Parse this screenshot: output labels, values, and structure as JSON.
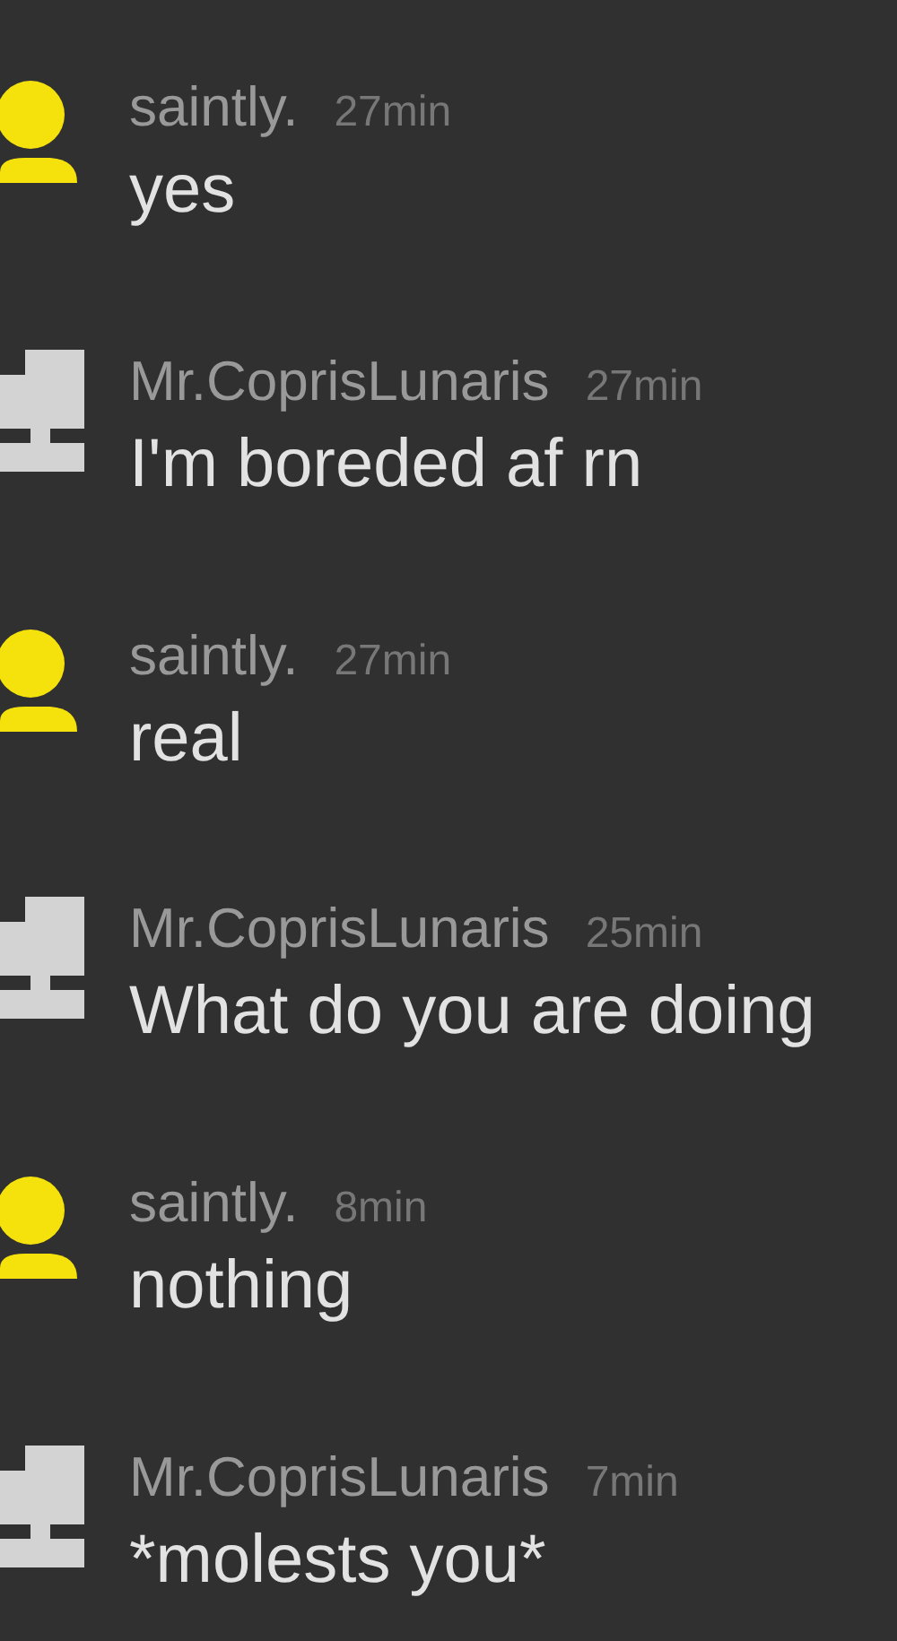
{
  "messages": [
    {
      "kind": "person",
      "name": "saintly.",
      "time": "27min",
      "text": "yes"
    },
    {
      "kind": "block",
      "name": "Mr.CoprisLunaris",
      "time": "27min",
      "text": "I'm boreded af rn"
    },
    {
      "kind": "person",
      "name": "saintly.",
      "time": "27min",
      "text": "real"
    },
    {
      "kind": "block",
      "name": "Mr.CoprisLunaris",
      "time": "25min",
      "text": "What do you are doing"
    },
    {
      "kind": "person",
      "name": "saintly.",
      "time": "8min",
      "text": "nothing"
    },
    {
      "kind": "block",
      "name": "Mr.CoprisLunaris",
      "time": "7min",
      "text": "*molests you*"
    }
  ]
}
